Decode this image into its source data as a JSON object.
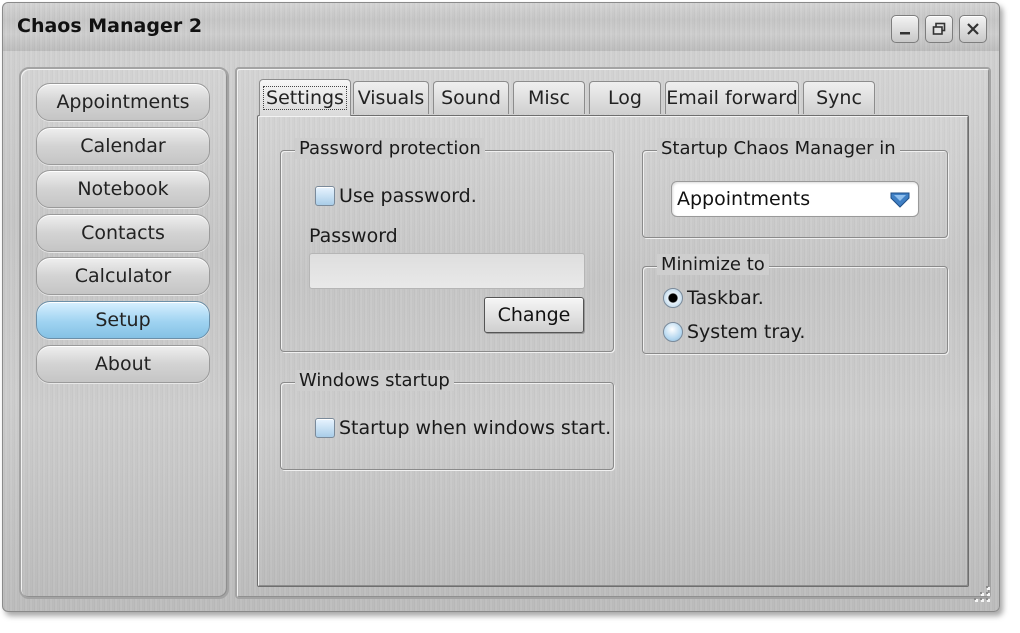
{
  "window": {
    "title": "Chaos Manager 2",
    "controls": [
      "minimize-icon",
      "restore-icon",
      "close-icon"
    ]
  },
  "sidebar": {
    "items": [
      {
        "label": "Appointments",
        "active": false
      },
      {
        "label": "Calendar",
        "active": false
      },
      {
        "label": "Notebook",
        "active": false
      },
      {
        "label": "Contacts",
        "active": false
      },
      {
        "label": "Calculator",
        "active": false
      },
      {
        "label": "Setup",
        "active": true
      },
      {
        "label": "About",
        "active": false
      }
    ]
  },
  "tabs": [
    {
      "label": "Settings",
      "active": true
    },
    {
      "label": "Visuals",
      "active": false
    },
    {
      "label": "Sound",
      "active": false
    },
    {
      "label": "Misc",
      "active": false
    },
    {
      "label": "Log",
      "active": false
    },
    {
      "label": "Email forward",
      "active": false
    },
    {
      "label": "Sync",
      "active": false
    }
  ],
  "settings": {
    "password_group": {
      "legend": "Password protection",
      "use_password_label": "Use password.",
      "use_password_checked": false,
      "password_label": "Password",
      "password_value": "",
      "change_button": "Change"
    },
    "windows_startup_group": {
      "legend": "Windows startup",
      "startup_label": "Startup when windows start.",
      "startup_checked": false
    },
    "startup_in_group": {
      "legend": "Startup Chaos Manager in",
      "selected": "Appointments"
    },
    "minimize_group": {
      "legend": "Minimize to",
      "options": [
        {
          "label": "Taskbar.",
          "checked": true
        },
        {
          "label": "System tray.",
          "checked": false
        }
      ]
    }
  },
  "colors": {
    "metal_light": "#d6d6d6",
    "metal_dark": "#bdbdbd",
    "active_nav": "#9fd3f1",
    "dropdown_arrow": "#3f7fc4"
  }
}
